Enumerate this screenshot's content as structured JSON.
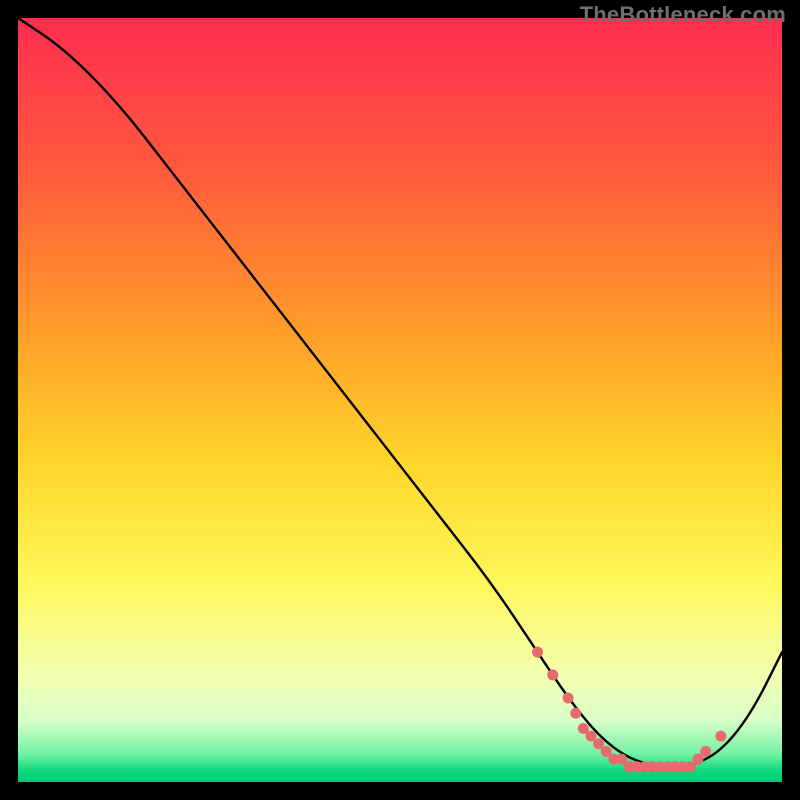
{
  "watermark": "TheBottleneck.com",
  "chart_data": {
    "type": "line",
    "title": "",
    "xlabel": "",
    "ylabel": "",
    "xlim": [
      0,
      100
    ],
    "ylim": [
      0,
      100
    ],
    "grid": false,
    "legend": false,
    "series": [
      {
        "name": "curve",
        "x": [
          0,
          6,
          13,
          20,
          27,
          34,
          41,
          48,
          55,
          62,
          68,
          72,
          76,
          80,
          84,
          88,
          92,
          96,
          100
        ],
        "y": [
          100,
          96,
          89,
          80,
          71,
          62,
          53,
          44,
          35,
          26,
          17,
          11,
          6,
          3,
          2,
          2,
          4,
          9,
          17
        ]
      }
    ],
    "markers": {
      "name": "highlight-dots",
      "color": "#e86a6f",
      "x": [
        68,
        70,
        72,
        73,
        74,
        75,
        76,
        77,
        78,
        79,
        80,
        81,
        82,
        83,
        84,
        85,
        86,
        87,
        88,
        89,
        90,
        92
      ],
      "y": [
        17,
        14,
        11,
        9,
        7,
        6,
        5,
        4,
        3,
        3,
        2,
        2,
        2,
        2,
        2,
        2,
        2,
        2,
        2,
        3,
        4,
        6
      ]
    },
    "gradient_stops": [
      {
        "offset": 0.0,
        "color": "#ff2d4f"
      },
      {
        "offset": 0.2,
        "color": "#ff5a3d"
      },
      {
        "offset": 0.4,
        "color": "#ff9a2a"
      },
      {
        "offset": 0.58,
        "color": "#ffd52a"
      },
      {
        "offset": 0.74,
        "color": "#fff85a"
      },
      {
        "offset": 0.86,
        "color": "#f2ffb0"
      },
      {
        "offset": 0.92,
        "color": "#d8ffc8"
      },
      {
        "offset": 0.965,
        "color": "#6cf0a0"
      },
      {
        "offset": 0.985,
        "color": "#10d980"
      },
      {
        "offset": 1.0,
        "color": "#04c777"
      }
    ]
  }
}
